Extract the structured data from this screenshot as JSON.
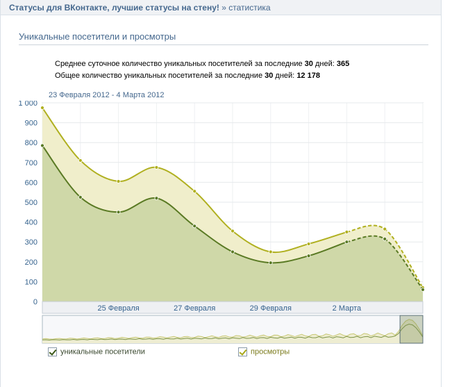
{
  "header": {
    "app_title": "Статусы для ВКонтакте, лучшие статусы на стену!",
    "separator": "»",
    "crumb": "статистика"
  },
  "section": {
    "title": "Уникальные посетители и просмотры"
  },
  "stats": {
    "avg_prefix": "Среднее суточное количество уникальных посетителей за последние ",
    "avg_days": "30",
    "avg_suffix": " дней: ",
    "avg_value": "365",
    "total_prefix": "Общее количество уникальных посетителей за последние ",
    "total_days": "30",
    "total_suffix": " дней: ",
    "total_value": "12 178"
  },
  "date_range": "23 Февраля 2012 - 4 Марта 2012",
  "colors": {
    "visitors": "#5a7a24",
    "visitors_fill": "#cfd8a8",
    "views": "#b0b020",
    "views_fill": "#f0eecb"
  },
  "legend": {
    "visitors": "уникальные посетители",
    "views": "просмотры"
  },
  "chart_data": {
    "type": "area",
    "ylim": [
      0,
      1000
    ],
    "y_ticks": [
      "0",
      "100",
      "200",
      "300",
      "400",
      "500",
      "600",
      "700",
      "800",
      "900",
      "1 000"
    ],
    "x_tick_labels": [
      "25 Февраля",
      "27 Февраля",
      "29 Февраля",
      "2 Марта"
    ],
    "x_tick_positions": [
      2,
      4,
      6,
      8
    ],
    "x": [
      0,
      1,
      2,
      3,
      4,
      5,
      6,
      7,
      8,
      9,
      10
    ],
    "series": [
      {
        "name": "просмотры",
        "values": [
          975,
          710,
          605,
          675,
          555,
          355,
          250,
          290,
          350,
          365,
          70
        ],
        "dashed_from_index": 8
      },
      {
        "name": "уникальные посетители",
        "values": [
          785,
          525,
          450,
          520,
          380,
          250,
          195,
          230,
          300,
          315,
          60
        ],
        "dashed_from_index": 8
      }
    ]
  }
}
